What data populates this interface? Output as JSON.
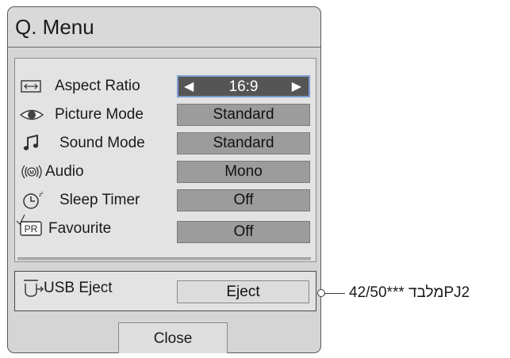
{
  "title": "Q. Menu",
  "items": [
    {
      "icon": "aspect-ratio-icon",
      "label": "Aspect Ratio",
      "value": "16:9",
      "left_arrow": "◀",
      "right_arrow": "▶"
    },
    {
      "icon": "eye-icon",
      "label": "Picture Mode",
      "value": "Standard"
    },
    {
      "icon": "music-note-icon",
      "label": "Sound Mode",
      "value": "Standard"
    },
    {
      "icon": "audio-icon",
      "label": "Audio",
      "value": "Mono"
    },
    {
      "icon": "sleep-timer-icon",
      "label": "Sleep Timer",
      "value": "Off"
    },
    {
      "icon": "favourite-pr-icon",
      "label": "Favourite",
      "value": "Off"
    }
  ],
  "usb": {
    "icon": "usb-icon",
    "label": "USB Eject",
    "button": "Eject"
  },
  "close_label": "Close",
  "callout_text": "מלבד ***42/50PJ2",
  "colors": {
    "panel": "#d5d5d5",
    "value_box": "#9c9c9c",
    "value_box_active": "#555555",
    "active_border": "#7a9bd0"
  }
}
